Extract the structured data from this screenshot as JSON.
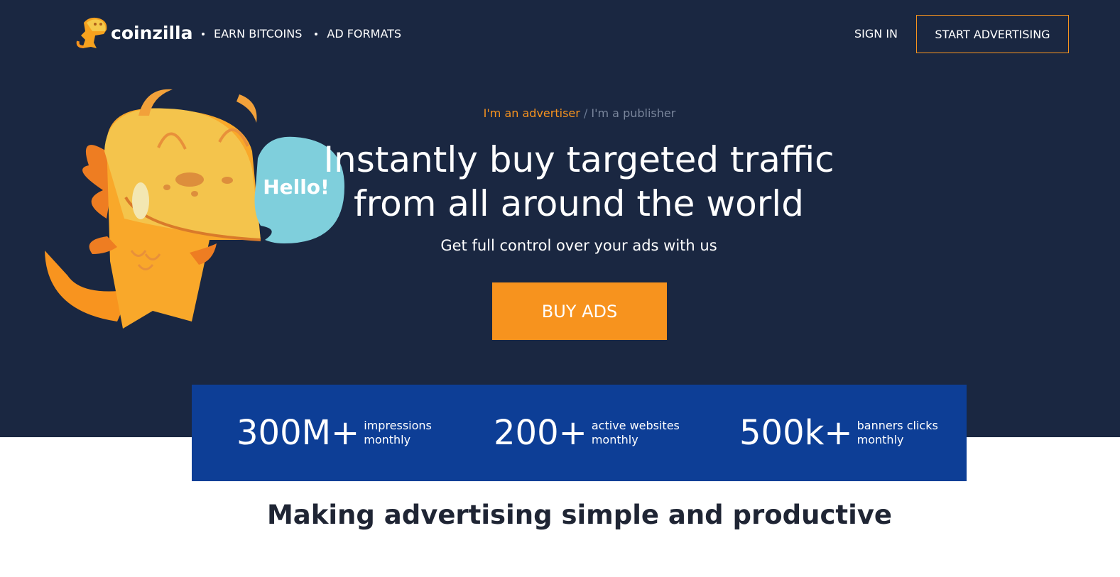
{
  "header": {
    "logo_text": "coinzilla",
    "nav": [
      {
        "label": "EARN BITCOINS"
      },
      {
        "label": "AD FORMATS"
      }
    ],
    "sign_in": "SIGN IN",
    "start_advertising": "START ADVERTISING"
  },
  "hero": {
    "role_advertiser": "I'm an advertiser",
    "role_separator": " / ",
    "role_publisher": "I'm a publisher",
    "headline_line1": "Instantly buy targeted traffic",
    "headline_line2": "from all around the world",
    "subheadline": "Get full control over your ads with us",
    "cta": "BUY ADS",
    "speech_bubble": "Hello!"
  },
  "stats": [
    {
      "value": "300M+",
      "desc_line1": "impressions",
      "desc_line2": "monthly"
    },
    {
      "value": "200+",
      "desc_line1": "active websites",
      "desc_line2": "monthly"
    },
    {
      "value": "500k+",
      "desc_line1": "banners clicks",
      "desc_line2": "monthly"
    }
  ],
  "tagline": "Making advertising simple and productive",
  "colors": {
    "hero_bg": "#1a2741",
    "accent": "#f7931e",
    "stats_bg": "#0d3e96",
    "bubble": "#7fcfdc"
  },
  "icons": {
    "logo": "dinosaur-logo-icon",
    "mascot": "dinosaur-mascot-illustration"
  }
}
